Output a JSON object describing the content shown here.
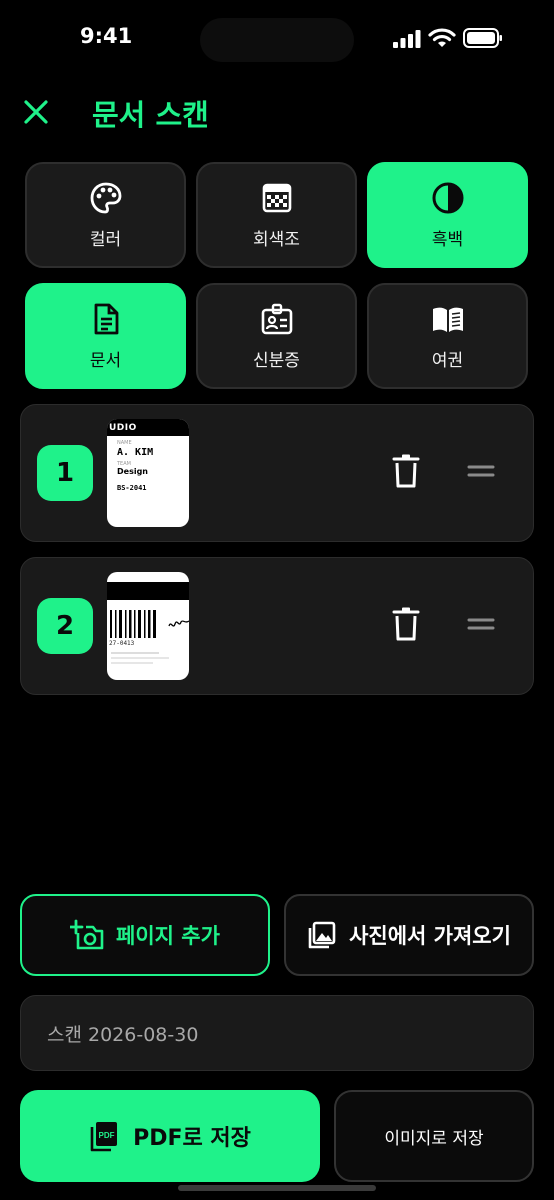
{
  "status": {
    "time": "9:41"
  },
  "header": {
    "title": "문서 스캔"
  },
  "color_modes": [
    {
      "label": "컬러",
      "icon": "palette-icon",
      "active": false
    },
    {
      "label": "회색조",
      "icon": "grayscale-icon",
      "active": false
    },
    {
      "label": "흑백",
      "icon": "contrast-icon",
      "active": true
    }
  ],
  "doc_types": [
    {
      "label": "문서",
      "icon": "document-icon",
      "active": true
    },
    {
      "label": "신분증",
      "icon": "id-card-icon",
      "active": false
    },
    {
      "label": "여권",
      "icon": "passport-book-icon",
      "active": false
    }
  ],
  "pages": [
    {
      "number": "1",
      "thumb": {
        "header": "UDIO",
        "small1": "NAME",
        "name": "A. KIM",
        "small2": "TEAM",
        "dept": "Design",
        "code": "BS-2041"
      }
    },
    {
      "number": "2",
      "thumb": {
        "code": "27-0413"
      }
    }
  ],
  "actions": {
    "add_page": "페이지 추가",
    "import_photo": "사진에서 가져오기"
  },
  "filename": {
    "value": "스캔 2026-08-30"
  },
  "save": {
    "pdf": "PDF로 저장",
    "image": "이미지로 저장"
  },
  "colors": {
    "accent": "#1ff28a",
    "background": "#000000",
    "card": "#1a1a1a"
  }
}
